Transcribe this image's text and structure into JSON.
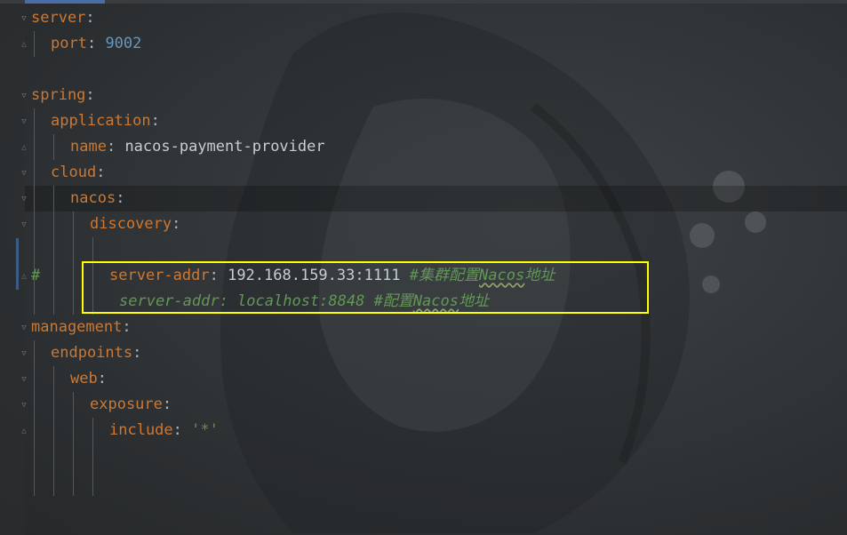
{
  "editor": {
    "lines": {
      "l1": {
        "key": "server",
        "colon": ":"
      },
      "l2": {
        "key": "port",
        "colon": ": ",
        "value": "9002"
      },
      "l4": {
        "key": "spring",
        "colon": ":"
      },
      "l5": {
        "key": "application",
        "colon": ":"
      },
      "l6": {
        "key": "name",
        "colon": ": ",
        "value": "nacos-payment-provider"
      },
      "l7": {
        "key": "cloud",
        "colon": ":"
      },
      "l8": {
        "key": "nacos",
        "colon": ":"
      },
      "l9": {
        "key": "discovery",
        "colon": ":"
      },
      "l10": {
        "hash": "#",
        "comment_prefix": "server-addr: localhost:8848 #配置",
        "comment_word": "Nacos",
        "comment_suffix": "地址"
      },
      "l11": {
        "key": "server-addr",
        "colon": ": ",
        "value": "192.168.159.33:1111 ",
        "comment_prefix": "#集群配置",
        "comment_word": "Nacos",
        "comment_suffix": "地址"
      },
      "l13": {
        "key": "management",
        "colon": ":"
      },
      "l14": {
        "key": "endpoints",
        "colon": ":"
      },
      "l15": {
        "key": "web",
        "colon": ":"
      },
      "l16": {
        "key": "exposure",
        "colon": ":"
      },
      "l17": {
        "key": "include",
        "colon": ": ",
        "value": "'*'"
      }
    }
  },
  "colors": {
    "key": "#cc7832",
    "number": "#6897bb",
    "string": "#6a8759",
    "comment": "#629755",
    "plain": "#a9b7c6",
    "highlight_box": "#ffff00"
  }
}
